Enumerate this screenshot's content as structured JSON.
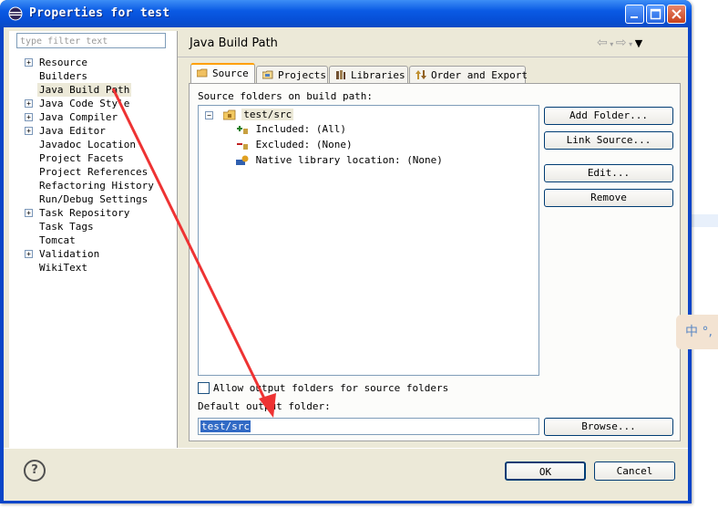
{
  "window": {
    "title": "Properties for test"
  },
  "sidebar": {
    "filter_placeholder": "type filter text",
    "items": [
      {
        "label": "Resource",
        "expandable": true
      },
      {
        "label": "Builders",
        "expandable": false
      },
      {
        "label": "Java Build Path",
        "expandable": false,
        "selected": true
      },
      {
        "label": "Java Code Style",
        "expandable": true
      },
      {
        "label": "Java Compiler",
        "expandable": true
      },
      {
        "label": "Java Editor",
        "expandable": true
      },
      {
        "label": "Javadoc Location",
        "expandable": false
      },
      {
        "label": "Project Facets",
        "expandable": false
      },
      {
        "label": "Project References",
        "expandable": false
      },
      {
        "label": "Refactoring History",
        "expandable": false
      },
      {
        "label": "Run/Debug Settings",
        "expandable": false
      },
      {
        "label": "Task Repository",
        "expandable": true
      },
      {
        "label": "Task Tags",
        "expandable": false
      },
      {
        "label": "Tomcat",
        "expandable": false
      },
      {
        "label": "Validation",
        "expandable": true
      },
      {
        "label": "WikiText",
        "expandable": false
      }
    ]
  },
  "main": {
    "title": "Java Build Path",
    "tabs": [
      {
        "label": "Source",
        "icon": "source-folder-icon",
        "active": true
      },
      {
        "label": "Projects",
        "icon": "projects-icon"
      },
      {
        "label": "Libraries",
        "icon": "libraries-icon"
      },
      {
        "label": "Order and Export",
        "icon": "order-export-icon"
      }
    ],
    "source_label": "Source folders on build path:",
    "tree": {
      "root": "test/src",
      "children": [
        "Included: (All)",
        "Excluded: (None)",
        "Native library location: (None)"
      ]
    },
    "buttons": {
      "add_folder": "Add Folder...",
      "link_source": "Link Source...",
      "edit": "Edit...",
      "remove": "Remove",
      "browse": "Browse..."
    },
    "allow_output_label": "Allow output folders for source folders",
    "default_output_label": "Default output folder:",
    "default_output_value": "test/src"
  },
  "footer": {
    "ok": "OK",
    "cancel": "Cancel"
  },
  "ime_indicator": "中 °,",
  "colors": {
    "titlebar": "#0a5ae4",
    "dialog_bg": "#ece9d8",
    "selection": "#316ac5",
    "annotation_arrow": "#ee3333"
  }
}
